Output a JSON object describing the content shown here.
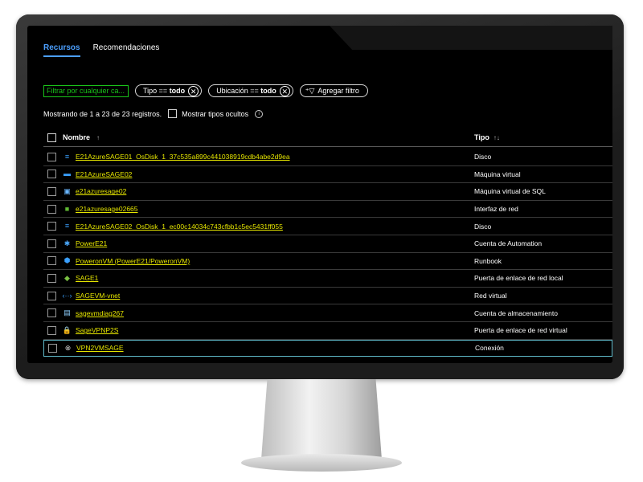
{
  "tabs": [
    {
      "label": "Recursos",
      "active": true
    },
    {
      "label": "Recomendaciones",
      "active": false
    }
  ],
  "filters": {
    "search_placeholder": "Filtrar por cualquier ca...",
    "pills": [
      {
        "label": "Tipo == ",
        "value": "todo"
      },
      {
        "label": "Ubicación == ",
        "value": "todo"
      }
    ],
    "add_filter_label": "Agregar filtro"
  },
  "status": {
    "records_text": "Mostrando de 1 a 23 de 23 registros.",
    "show_hidden_label": "Mostrar tipos ocultos"
  },
  "table": {
    "columns": {
      "name": "Nombre",
      "name_sort": "↑",
      "type": "Tipo",
      "type_sort": "↑↓"
    },
    "rows": [
      {
        "name": "E21AzureSAGE01_OsDisk_1_37c535a899c441038919cdb4abe2d9ea",
        "type": "Disco",
        "icon": "disk-icon",
        "glyph": "≡",
        "color": "#3aa0ff"
      },
      {
        "name": "E21AzureSAGE02",
        "type": "Máquina virtual",
        "icon": "virtual-machine-icon",
        "glyph": "▬",
        "color": "#3aa0ff"
      },
      {
        "name": "e21azuresage02",
        "type": "Máquina virtual de SQL",
        "icon": "sql-vm-icon",
        "glyph": "▣",
        "color": "#6ab7ff"
      },
      {
        "name": "e21azuresage02665",
        "type": "Interfaz de red",
        "icon": "network-interface-icon",
        "glyph": "■",
        "color": "#5fb832"
      },
      {
        "name": "E21AzureSAGE02_OsDisk_1_ec00c14034c743cfbb1c5ec5431ff055",
        "type": "Disco",
        "icon": "disk-icon",
        "glyph": "≡",
        "color": "#3aa0ff"
      },
      {
        "name": "PowerE21",
        "type": "Cuenta de Automation",
        "icon": "automation-account-icon",
        "glyph": "✱",
        "color": "#4aa8ff"
      },
      {
        "name": "PoweronVM (PowerE21/PoweronVM)",
        "type": "Runbook",
        "icon": "runbook-icon",
        "glyph": "⬢",
        "color": "#3aa0ff"
      },
      {
        "name": "SAGE1",
        "type": "Puerta de enlace de red local",
        "icon": "local-gateway-icon",
        "glyph": "◆",
        "color": "#7ac142"
      },
      {
        "name": "SAGEVM-vnet",
        "type": "Red virtual",
        "icon": "virtual-network-icon",
        "glyph": "‹··›",
        "color": "#3aa0ff"
      },
      {
        "name": "sagevmdiag267",
        "type": "Cuenta de almacenamiento",
        "icon": "storage-account-icon",
        "glyph": "▤",
        "color": "#8fd0ff"
      },
      {
        "name": "SageVPNP2S",
        "type": "Puerta de enlace de red virtual",
        "icon": "vpn-gateway-icon",
        "glyph": "🔒",
        "color": "#3aa0ff"
      },
      {
        "name": "VPN2VMSAGE",
        "type": "Conexión",
        "icon": "connection-icon",
        "glyph": "⊗",
        "color": "#d0d0d0",
        "selected": true
      }
    ]
  },
  "colors": {
    "accent": "#4ca0ff",
    "link": "#e6e600",
    "filter_border": "#19c319"
  }
}
